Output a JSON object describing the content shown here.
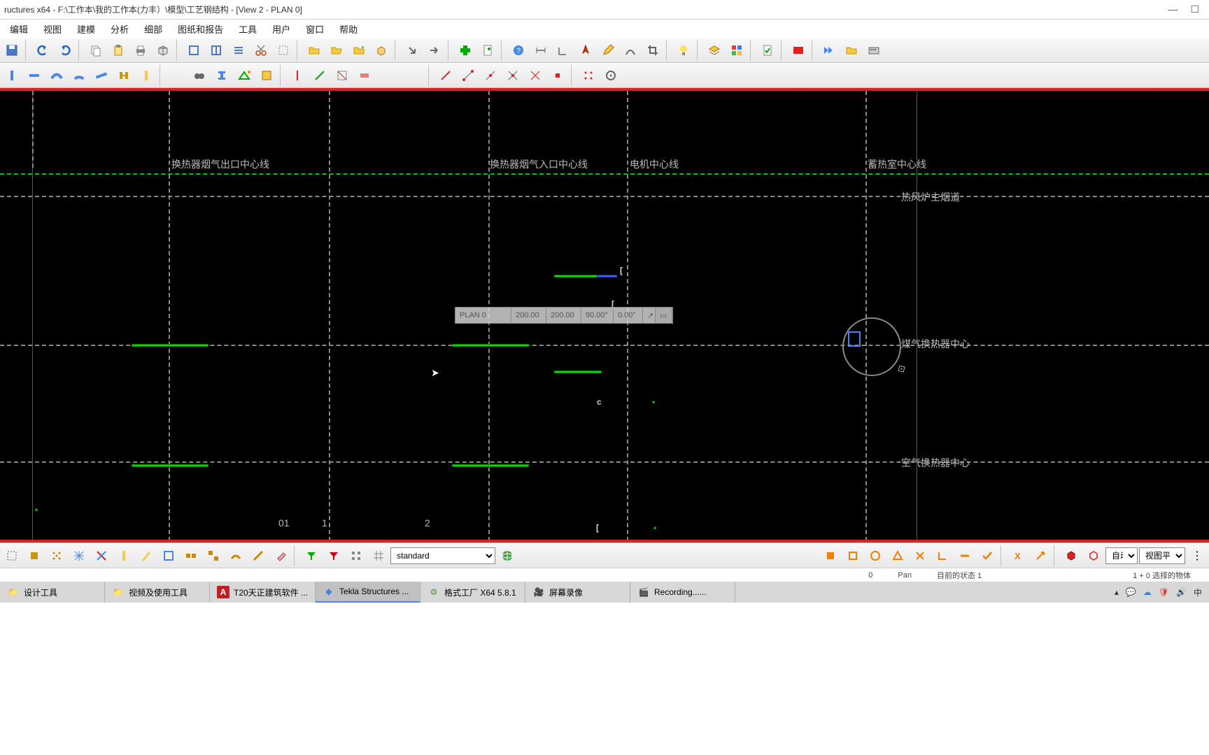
{
  "title": "ructures x64 - F:\\工作本\\我的工作本(力丰）\\模型\\工艺钢结构 - [View 2 - PLAN 0]",
  "menu": [
    "编辑",
    "视图",
    "建模",
    "分析",
    "细部",
    "图纸和报告",
    "工具",
    "用户",
    "窗口",
    "帮助"
  ],
  "float_bar": {
    "label": "PLAN 0",
    "v1": "200.00",
    "v2": "200.00",
    "v3": "90.00°",
    "v4": "0.00°"
  },
  "grid_labels": {
    "v": [
      "换热器烟气出口中心线",
      "换热器烟气入口中心线",
      "电机中心线",
      "蓄热室中心线"
    ],
    "h": [
      "热风炉主烟道",
      "煤气换热器中心",
      "空气换热器中心"
    ],
    "nums": [
      "01",
      "1",
      "2"
    ]
  },
  "bottom_combo": "standard",
  "right_combos": {
    "c1": "自动",
    "c2": "视图平面"
  },
  "status": {
    "zero": "0",
    "mode": "Pan",
    "state_label": "目前的状态",
    "state_val": "1",
    "sel": "1 + 0 选择的物体"
  },
  "taskbar": {
    "items": [
      {
        "label": "设计工具"
      },
      {
        "label": "视频及使用工具"
      },
      {
        "label": "T20天正建筑软件 ..."
      },
      {
        "label": "Tekla Structures ..."
      },
      {
        "label": "格式工厂 X64 5.8.1"
      },
      {
        "label": "屏幕录像"
      },
      {
        "label": "Recording......"
      }
    ],
    "ime": "中"
  }
}
